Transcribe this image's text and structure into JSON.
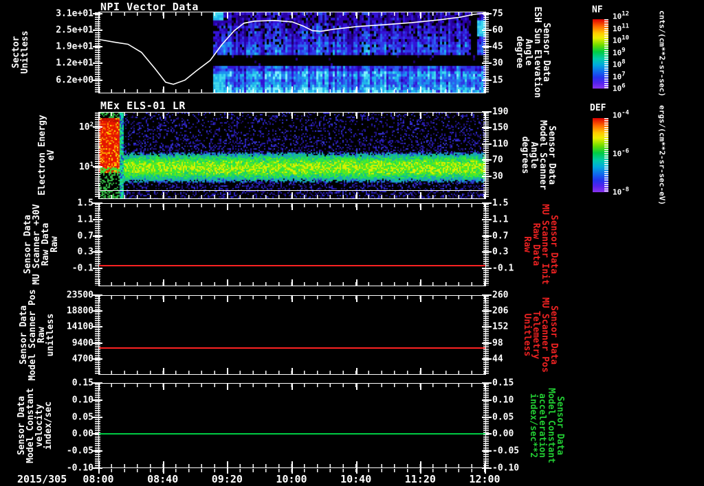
{
  "date_label": "2015/305",
  "time_axis": {
    "labels": [
      "08:00",
      "08:40",
      "09:20",
      "10:00",
      "10:40",
      "11:20",
      "12:00"
    ]
  },
  "colors": {
    "background": "#000000",
    "axis": "#ffffff",
    "red_label": "#ee2222",
    "green_label": "#22cc33",
    "red_line": "#ff2222",
    "green_line": "#00cc44",
    "white_line": "#ffffff"
  },
  "panels": [
    {
      "title": "NPI Vector Data",
      "left_label_lines": [
        "Sector",
        "Unitless"
      ],
      "left_ticks": [
        "3.1e+01",
        "2.5e+01",
        "1.9e+01",
        "1.2e+01",
        "6.2e+00"
      ],
      "right_ticks": [
        "75",
        "60",
        "45",
        "30",
        "15"
      ],
      "right_label_lines": [
        "Sensor Data",
        "ESH Sun Elevation",
        "Angle",
        "degree"
      ],
      "colorbar": {
        "title": "NF",
        "ticks": [
          "10^12",
          "10^11",
          "10^10",
          "10^9",
          "10^8",
          "10^7",
          "10^6"
        ],
        "unit": "cnts/(cm**2-sr-sec)"
      }
    },
    {
      "title": "MEx ELS-01 LR",
      "left_label_lines": [
        "Electron Energy",
        "eV"
      ],
      "left_ticks": [
        "10^2",
        "10^1"
      ],
      "right_ticks": [
        "190",
        "150",
        "110",
        "70",
        "30"
      ],
      "right_label_lines": [
        "Sensor Data",
        "Model Scanner",
        "Angle",
        "degrees"
      ],
      "colorbar": {
        "title": "DEF",
        "ticks": [
          "10^-4",
          "10^-6",
          "10^-8"
        ],
        "unit": "ergs/(cm**2-sr-sec-eV)"
      }
    },
    {
      "title": "",
      "left_label_lines": [
        "Sensor Data",
        "MU Scanner +30V",
        "Raw Data",
        "Raw"
      ],
      "left_ticks": [
        "1.5",
        "1.1",
        "0.7",
        "0.3",
        "-0.1"
      ],
      "right_ticks": [
        "1.5",
        "1.1",
        "0.7",
        "0.3",
        "-0.1"
      ],
      "right_label_lines": [
        "Sensor Data",
        "MU Scanner Init",
        "Raw Data",
        "Raw"
      ]
    },
    {
      "title": "",
      "left_label_lines": [
        "Sensor Data",
        "Model Scanner Pos",
        "Raw",
        "unitless"
      ],
      "left_ticks": [
        "23500",
        "18800",
        "14100",
        "9400",
        "4700"
      ],
      "right_ticks": [
        "260",
        "206",
        "152",
        "98",
        "44"
      ],
      "right_label_lines": [
        "Sensor Data",
        "MU Scanner Pos",
        "Telemetry",
        "Unitless"
      ]
    },
    {
      "title": "",
      "left_label_lines": [
        "Sensor Data",
        "Model Constant",
        "velocity",
        "index/sec"
      ],
      "left_ticks": [
        "0.15",
        "0.10",
        "0.05",
        "0.00",
        "-0.05",
        "-0.10"
      ],
      "right_ticks": [
        "0.15",
        "0.10",
        "0.05",
        "0.00",
        "-0.05",
        "-0.10"
      ],
      "right_label_lines": [
        "Sensor Data",
        "Model Constant",
        "acceleration",
        "index/sec**2"
      ]
    }
  ],
  "chart_data": [
    {
      "type": "heatmap",
      "title": "NPI Vector Data",
      "x_axis": {
        "start": "2015/305 08:00",
        "end": "2015/305 12:00",
        "major_ticks": [
          "08:00",
          "08:40",
          "09:20",
          "10:00",
          "10:40",
          "11:20",
          "12:00"
        ]
      },
      "y_left": {
        "label": "Sector Unitless",
        "tick_values": [
          31,
          25,
          19,
          12,
          6.2
        ]
      },
      "y_right": {
        "label": "ESH Sun Elevation Angle (degree)",
        "tick_values": [
          75,
          60,
          45,
          30,
          15
        ]
      },
      "colorbar": {
        "name": "NF",
        "scale": "log",
        "unit": "cnts/(cm**2-sr-sec)",
        "tick_values": [
          "1e12",
          "1e11",
          "1e10",
          "1e9",
          "1e8",
          "1e7",
          "1e6"
        ]
      },
      "heatmap": {
        "data_start_hour": 9.18,
        "description": "blue/purple sector-vs-time spectrogram beginning ~09:11; solid black band across ~30-40 deg rows; brightest cyan rows near bottom; bright cyan column ~10:15"
      },
      "line": {
        "name": "ESH Sun Elevation Angle",
        "unit": "degree",
        "t_hours": [
          8.0,
          8.16,
          8.3,
          8.44,
          8.58,
          8.69,
          8.77,
          8.89,
          9.01,
          9.15,
          9.27,
          9.4,
          9.5,
          9.61,
          9.82,
          10.0,
          10.11,
          10.21,
          10.3,
          10.43,
          10.67,
          10.96,
          11.24,
          11.52,
          11.74,
          11.88,
          12.0
        ],
        "values": [
          51.9,
          49.4,
          47.5,
          40.0,
          25.0,
          12.5,
          10.6,
          14.4,
          23.1,
          32.5,
          46.9,
          60.0,
          66.9,
          68.8,
          69.4,
          68.1,
          64.4,
          60.0,
          59.4,
          61.3,
          63.8,
          65.6,
          67.5,
          70.0,
          72.5,
          75.0,
          77.3
        ]
      }
    },
    {
      "type": "heatmap",
      "title": "MEx ELS-01 LR",
      "y_left": {
        "label": "Electron Energy (eV)",
        "scale": "log",
        "tick_values": [
          "1e2",
          "1e1"
        ]
      },
      "y_right": {
        "label": "Model Scanner Angle (degrees)",
        "tick_values": [
          190,
          150,
          110,
          70,
          30
        ]
      },
      "colorbar": {
        "name": "DEF",
        "scale": "log",
        "unit": "ergs/(cm**2-sr-sec-eV)",
        "tick_values": [
          "1e-4",
          "1e-6",
          "1e-8"
        ]
      },
      "heatmap": {
        "features": [
          "intense red/orange burst 08:00-08:12 spanning ~5-100+ eV",
          "narrow green-cyan vertical streak near 08:13",
          "continuous yellow-green band near 10 eV for whole interval",
          "sparse blue noise speckle elsewhere"
        ]
      }
    },
    {
      "type": "line",
      "title": "MU Scanner +30V Raw",
      "y_range": [
        -0.5,
        1.5
      ],
      "series": [
        {
          "name": "MU Scanner +30V Raw Data Raw",
          "color": "#ff2222",
          "constant_value": 0.0
        }
      ]
    },
    {
      "type": "line",
      "title": "Model Scanner Pos Raw",
      "y_range": [
        0,
        23500
      ],
      "series": [
        {
          "name": "Model Scanner Pos Raw unitless",
          "color": "#ff2222",
          "constant_value": 8000
        }
      ]
    },
    {
      "type": "line",
      "title": "Model Constant velocity",
      "y_range": [
        -0.1,
        0.15
      ],
      "series": [
        {
          "name": "Model Constant velocity index/sec",
          "color": "#00cc44",
          "constant_value": 0.0
        }
      ]
    }
  ]
}
